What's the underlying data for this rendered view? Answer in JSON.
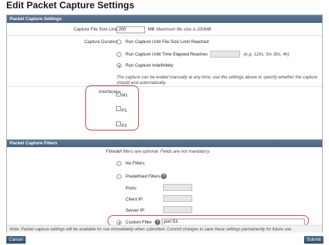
{
  "page": {
    "title": "Edit Packet Capture Settings"
  },
  "settings": {
    "header": "Packet Capture Settings",
    "file_size_label": "Capture File Size Limit:",
    "file_size_value": "200",
    "file_size_unit": "MB",
    "file_size_hint": "Maximum file size is 200MB",
    "duration_label": "Capture Duration:",
    "duration_options": [
      "Run Capture Until File Size Limit Reached",
      "Run Capture Until Time Elapsed Reaches",
      "Run Capture Indefinitely"
    ],
    "duration_selected": 2,
    "time_hint": "(e.g. 120s, 5m 30s, 4h)",
    "duration_note": "The capture can be ended manually at any time; use the settings above to specify whether the capture should end automatically.",
    "interfaces_label": "Interfaces:",
    "interfaces": [
      {
        "name": "M1",
        "checked": true
      },
      {
        "name": "P1",
        "checked": false
      },
      {
        "name": "P2",
        "checked": false
      }
    ]
  },
  "filters": {
    "header": "Packet Capture Filters",
    "filters_label": "Filters:",
    "filters_hint": "All filters are optional. Fields are not mandatory.",
    "options": [
      "No Filters",
      "Predefined Filters",
      "Custom Filter"
    ],
    "selected": 2,
    "ports_label": "Ports:",
    "client_ip_label": "Client IP:",
    "server_ip_label": "Server IP:",
    "custom_filter_value": "port 53",
    "help_icon_text": "?"
  },
  "note": "Note: Packet capture settings will be available for use immediately when submitted. Commit changes to save these settings permanently for future use.",
  "buttons": {
    "cancel": "Cancel",
    "submit": "Submit"
  },
  "colors": {
    "header_bg": "#4f6a89",
    "highlight": "#d9342b",
    "button_bg": "#3a5a80"
  }
}
